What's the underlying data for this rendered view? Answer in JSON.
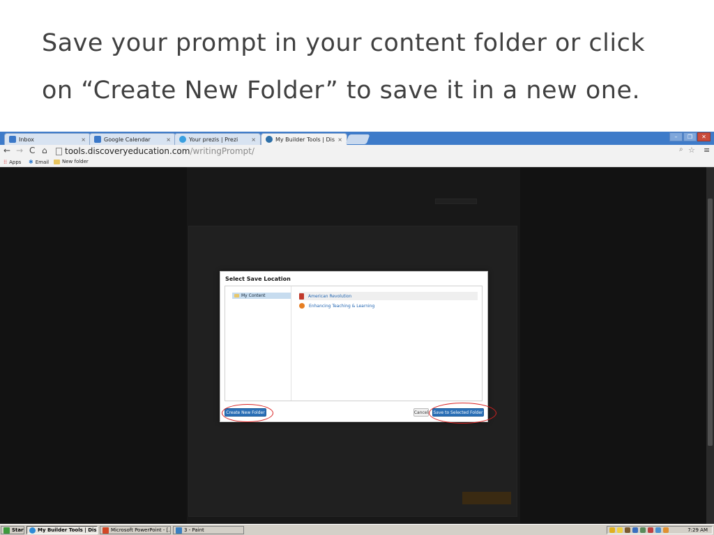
{
  "slide": {
    "title_line1": "Save your prompt in your content folder or click",
    "title_line2": "on “Create New Folder” to save it in a new one."
  },
  "browser": {
    "tabs": [
      {
        "label": "Inbox",
        "icon": "gmail-icon",
        "color": "#3b78c8"
      },
      {
        "label": "Google Calendar",
        "icon": "calendar-icon",
        "color": "#3b78c8"
      },
      {
        "label": "Your prezis | Prezi",
        "icon": "prezi-icon",
        "color": "#3aa0e0"
      },
      {
        "label": "My Builder Tools | Discovery",
        "icon": "discovery-icon",
        "color": "#2d6fa8"
      }
    ],
    "close_glyph": "×",
    "window_controls": [
      "–",
      "❐",
      "✕"
    ],
    "url_host": "tools.discoveryeducation.com",
    "url_path": "/writingPrompt/",
    "bookmarks": [
      {
        "label": "Apps",
        "icon": "apps-icon"
      },
      {
        "label": "Email",
        "icon": "email-icon"
      },
      {
        "label": "New folder",
        "icon": "folder-icon"
      }
    ]
  },
  "modal": {
    "title": "Select Save Location",
    "tree": [
      {
        "label": "My Content",
        "icon": "folder-icon"
      }
    ],
    "files": [
      {
        "label": "American Revolution",
        "icon": "book-icon",
        "color": "#c0392b"
      },
      {
        "label": "Enhancing Teaching & Learning",
        "icon": "globe-icon",
        "color": "#e67e22"
      }
    ],
    "create_label": "Create New Folder",
    "cancel_label": "Cancel",
    "save_label": "Save to Selected Folder"
  },
  "taskbar": {
    "start_label": "Start",
    "items": [
      {
        "label": "My Builder Tools | Dis...",
        "icon": "chrome-icon",
        "color": "#2e8bd6",
        "pressed": true
      },
      {
        "label": "Microsoft PowerPoint - [...",
        "icon": "powerpoint-icon",
        "color": "#d24726",
        "pressed": false
      },
      {
        "label": "3 - Paint",
        "icon": "paint-icon",
        "color": "#3a7fc1",
        "pressed": false
      }
    ],
    "clock": "7:29 AM"
  }
}
